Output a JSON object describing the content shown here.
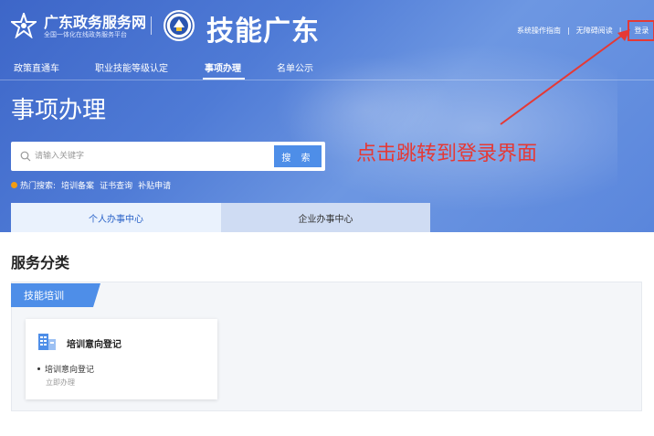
{
  "header": {
    "brand_main": "广东政务服务网",
    "brand_sub": "全国一体化在线政务服务平台",
    "site_title": "技能广东",
    "links": [
      "系统操作指南",
      "无障碍阅读",
      "登录"
    ]
  },
  "nav": {
    "items": [
      "政策直通车",
      "职业技能等级认定",
      "事项办理",
      "名单公示"
    ],
    "active": "事项办理"
  },
  "page_title": "事项办理",
  "search": {
    "placeholder": "请输入关键字",
    "button_label": "搜 索"
  },
  "hot": {
    "label": "热门搜索:",
    "links": [
      "培训备案",
      "证书查询",
      "补贴申请"
    ]
  },
  "tabs": [
    "个人办事中心",
    "企业办事中心"
  ],
  "annotation": "点击跳转到登录界面",
  "service": {
    "section_title": "服务分类",
    "category": "技能培训",
    "card": {
      "title": "培训意向登记",
      "item": "培训意向登记",
      "action": "立即办理"
    }
  },
  "colors": {
    "hero": "#4f7bd6",
    "accent": "#4e8ee8",
    "annotation": "#e53935",
    "hot_dot": "#f39c12"
  }
}
